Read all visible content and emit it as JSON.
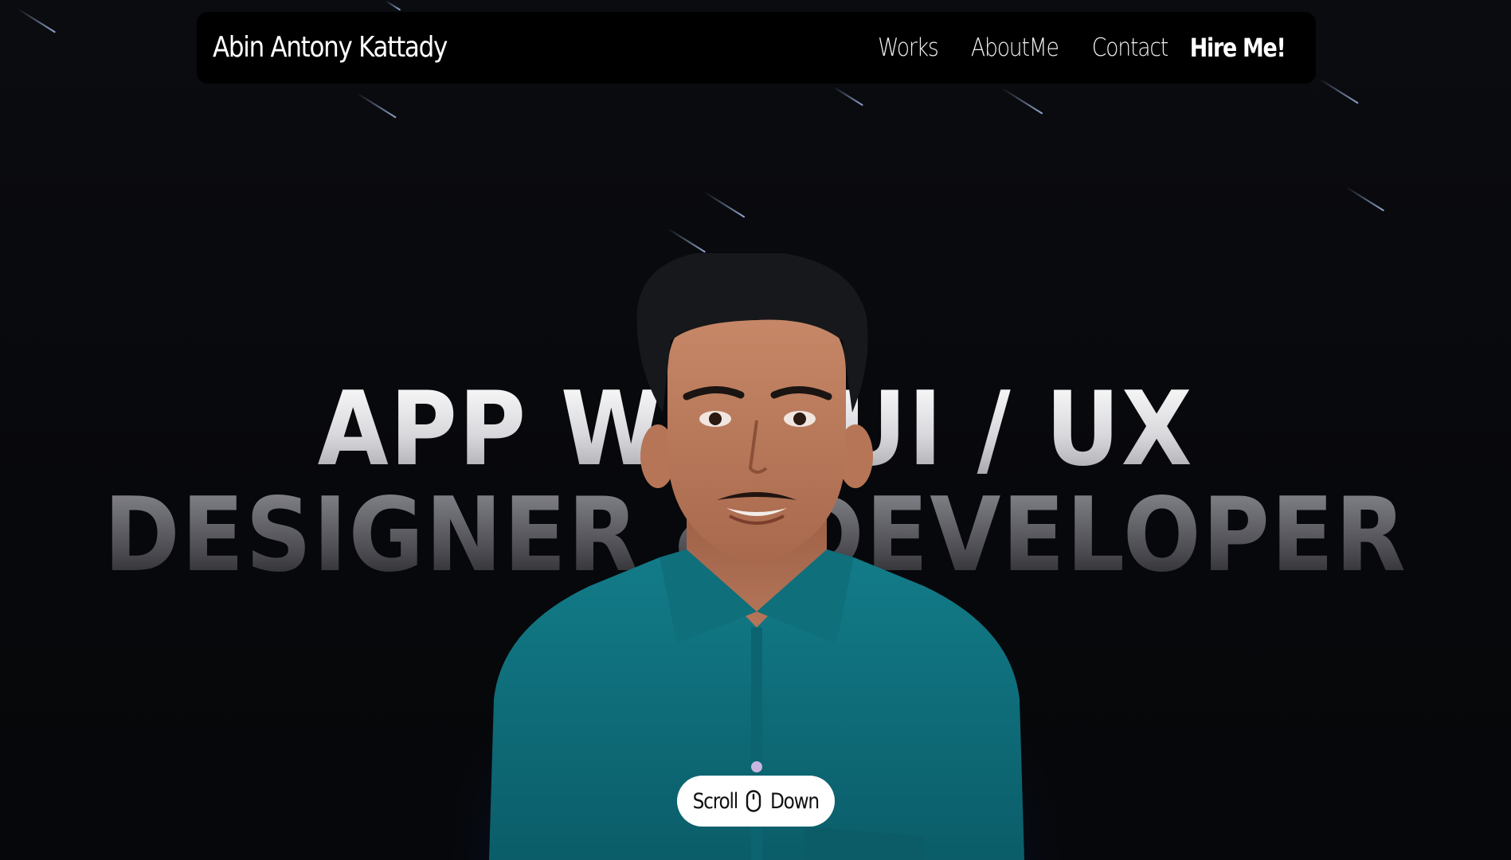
{
  "colors": {
    "background": "#07080b",
    "navbar": "#000000",
    "glow": "#1658d2",
    "shirt": "#0e6f7c",
    "button_bg": "#ffffff"
  },
  "header": {
    "brand": "Abin Antony Kattady",
    "nav": [
      "Works",
      "AboutMe",
      "Contact"
    ],
    "cta": "Hire Me!"
  },
  "hero": {
    "line1": "APP WEB UI / UX",
    "line2": "DESIGNER & DEVELOPER"
  },
  "scroll": {
    "left": "Scroll",
    "icon": "mouse-icon",
    "right": "Down"
  }
}
